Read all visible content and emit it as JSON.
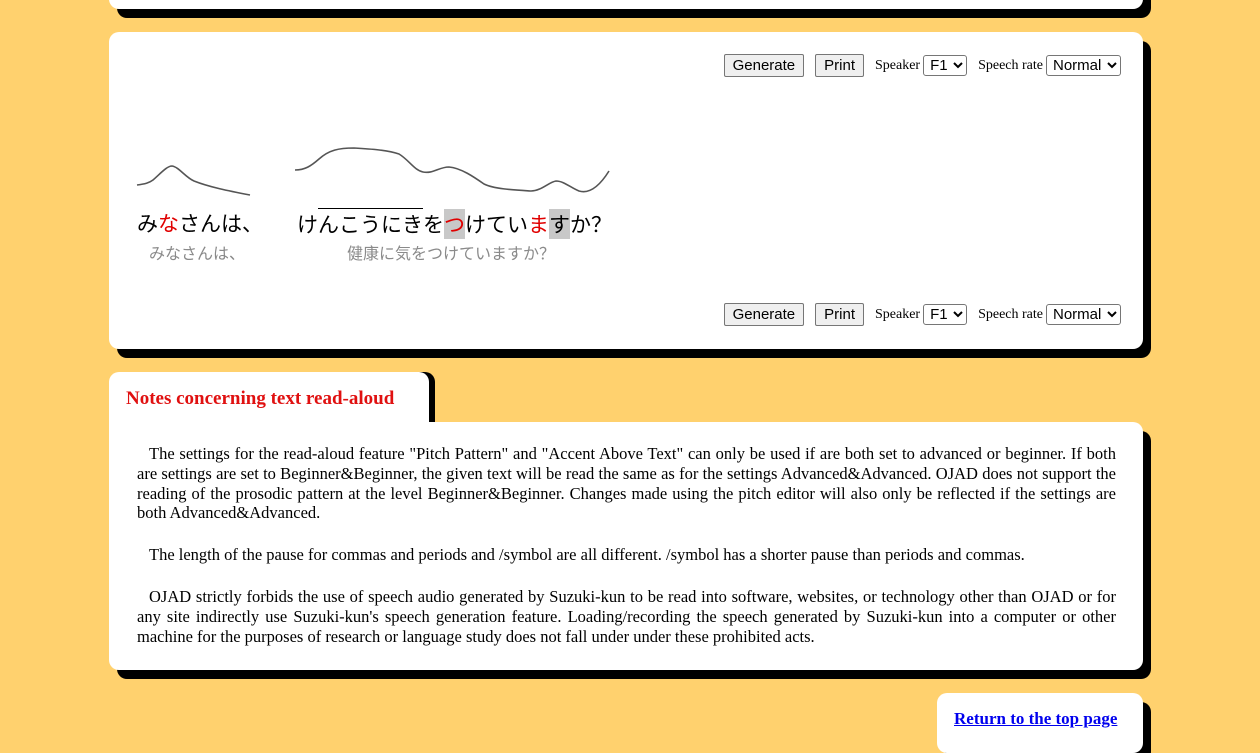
{
  "controls": {
    "generate_label": "Generate",
    "print_label": "Print",
    "speaker_label": "Speaker",
    "speaker_value": "F1",
    "rate_label": "Speech rate",
    "rate_value": "Normal"
  },
  "phrases": [
    {
      "segments": [
        {
          "text": "み",
          "style": "normal"
        },
        {
          "text": "な",
          "style": "red"
        },
        {
          "text": "さんは、",
          "style": "normal"
        }
      ],
      "original": "みなさんは、"
    },
    {
      "segments": [
        {
          "text": "け",
          "style": "normal"
        },
        {
          "text": "んこうにき",
          "style": "overline"
        },
        {
          "text": "を",
          "style": "normal"
        },
        {
          "text": "つ",
          "style": "red-gray"
        },
        {
          "text": "けてい",
          "style": "normal"
        },
        {
          "text": "ま",
          "style": "red"
        },
        {
          "text": "す",
          "style": "gray"
        },
        {
          "text": "か？",
          "style": "normal"
        }
      ],
      "original": "健康に気をつけていますか？"
    }
  ],
  "notes": {
    "title": "Notes concerning text read-aloud",
    "paragraphs": [
      "The settings for the read-aloud feature \"Pitch Pattern\" and \"Accent Above Text\" can only be used if are both set to advanced or beginner. If both are settings are set to Beginner&Beginner, the given text will be read the same as for the settings Advanced&Advanced. OJAD does not support the reading of the prosodic pattern at the level Beginner&Beginner. Changes made using the pitch editor will also only be reflected if the settings are both Advanced&Advanced.",
      "The length of the pause for commas and periods and /symbol are all different. /symbol has a shorter pause than periods and commas.",
      "OJAD strictly forbids the use of speech audio generated by Suzuki-kun to be read into software, websites, or technology other than OJAD or for any site indirectly use Suzuki-kun's speech generation feature. Loading/recording the speech generated by Suzuki-kun into a computer or other machine for the purposes of research or language study does not fall under under these prohibited acts."
    ]
  },
  "return_link": "Return to the top page"
}
